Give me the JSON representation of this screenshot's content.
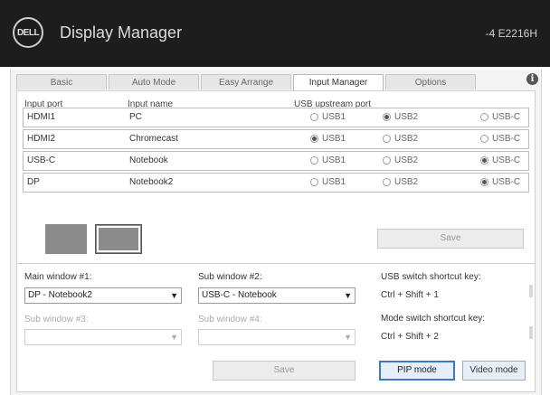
{
  "app": {
    "logo_text": "DELL",
    "title": "Display Manager",
    "right_info": "-4 E2216H"
  },
  "tabs": [
    {
      "label": "Basic"
    },
    {
      "label": "Auto Mode"
    },
    {
      "label": "Easy Arrange"
    },
    {
      "label": "Input Manager"
    },
    {
      "label": "Options"
    }
  ],
  "info_icon": "i",
  "input_table": {
    "headers": {
      "port": "Input port",
      "name": "Input name",
      "usb": "USB upstream port"
    },
    "rows": [
      {
        "port": "HDMI1",
        "name": "PC",
        "usb": [
          "USB1",
          "USB2",
          "USB-C"
        ],
        "selected": 1
      },
      {
        "port": "HDMI2",
        "name": "Chromecast",
        "usb": [
          "USB1",
          "USB2",
          "USB-C"
        ],
        "selected": 0
      },
      {
        "port": "USB-C",
        "name": "Notebook",
        "usb": [
          "USB1",
          "USB2",
          "USB-C"
        ],
        "selected": 2
      },
      {
        "port": "DP",
        "name": "Notebook2",
        "usb": [
          "USB1",
          "USB2",
          "USB-C"
        ],
        "selected": 2
      }
    ]
  },
  "save_top_label": "Save",
  "main_window": {
    "label": "Main window #1:",
    "value": "DP - Notebook2"
  },
  "sub_window_1": {
    "label": "Sub window #2:",
    "value": "USB-C - Notebook"
  },
  "sub_window_3": {
    "label": "Sub window #3:",
    "value": ""
  },
  "sub_window_4": {
    "label": "Sub window #4:",
    "value": ""
  },
  "usb_hotkey": {
    "label": "USB switch shortcut key:",
    "value": "Ctrl + Shift + 1"
  },
  "mode_hotkey": {
    "label": "Mode switch shortcut key:",
    "value": "Ctrl + Shift + 2"
  },
  "save_bottom_label": "Save",
  "pip_button_label": "PIP mode",
  "pbp_button_label": "Video mode"
}
